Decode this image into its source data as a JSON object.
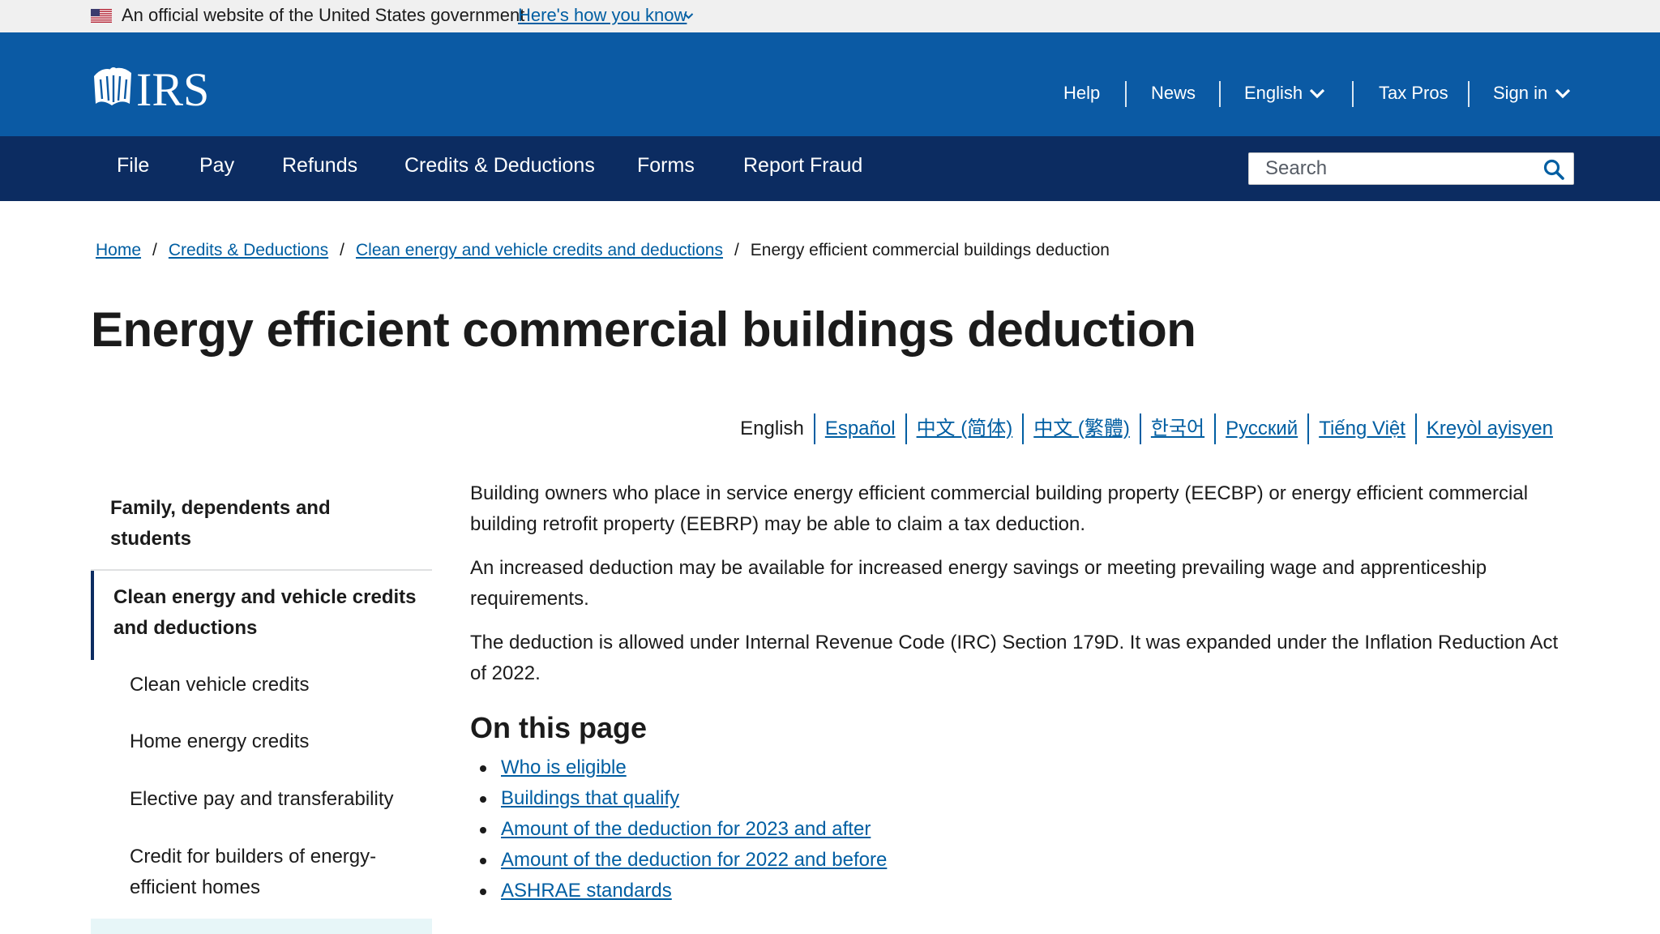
{
  "gov_banner": {
    "text": "An official website of the United States government",
    "link_label": "Here's how you know"
  },
  "header": {
    "logo_text": "IRS",
    "utility_nav": [
      {
        "label": "Help"
      },
      {
        "label": "News"
      },
      {
        "label": "English",
        "has_dropdown": true
      },
      {
        "label": "Tax Pros"
      },
      {
        "label": "Sign in",
        "has_dropdown": true
      }
    ]
  },
  "main_nav": {
    "items": [
      {
        "label": "File"
      },
      {
        "label": "Pay"
      },
      {
        "label": "Refunds"
      },
      {
        "label": "Credits & Deductions"
      },
      {
        "label": "Forms"
      },
      {
        "label": "Report Fraud"
      }
    ],
    "search_placeholder": "Search",
    "search_value": ""
  },
  "breadcrumb": [
    {
      "label": "Home",
      "is_link": true
    },
    {
      "label": "Credits & Deductions",
      "is_link": true
    },
    {
      "label": "Clean energy and vehicle credits and deductions",
      "is_link": true
    },
    {
      "label": "Energy efficient commercial buildings deduction",
      "is_link": false
    }
  ],
  "page_title": "Energy efficient commercial buildings deduction",
  "languages": [
    {
      "label": "English",
      "current": true
    },
    {
      "label": "Español"
    },
    {
      "label": "中文 (简体)"
    },
    {
      "label": "中文 (繁體)"
    },
    {
      "label": "한국어"
    },
    {
      "label": "Русский"
    },
    {
      "label": "Tiếng Việt"
    },
    {
      "label": "Kreyòl ayisyen"
    }
  ],
  "sidebar": {
    "group_label": "Family, dependents and students",
    "active_label": "Clean energy and vehicle credits and deductions",
    "sub_items": [
      {
        "label": "Clean vehicle credits"
      },
      {
        "label": "Home energy credits"
      },
      {
        "label": "Elective pay and transferability"
      },
      {
        "label": "Credit for builders of energy-efficient homes"
      }
    ]
  },
  "content": {
    "paragraphs": [
      "Building owners who place in service energy efficient commercial building property (EECBP) or energy efficient commercial building retrofit property (EEBRP) may be able to claim a tax deduction.",
      "An increased deduction may be available for increased energy savings or meeting prevailing wage and apprenticeship requirements.",
      "The deduction is allowed under Internal Revenue Code (IRC) Section 179D. It was expanded under the Inflation Reduction Act of 2022."
    ],
    "on_this_page_heading": "On this page",
    "toc": [
      {
        "label": "Who is eligible"
      },
      {
        "label": "Buildings that qualify"
      },
      {
        "label": "Amount of the deduction for 2023 and after"
      },
      {
        "label": "Amount of the deduction for 2022 and before"
      },
      {
        "label": "ASHRAE standards"
      }
    ]
  },
  "colors": {
    "header_blue": "#0b5aa4",
    "nav_navy": "#0c2c61",
    "link_blue": "#005ea2",
    "banner_gray": "#f0f0f0",
    "sidebar_next_bg": "#e7f6f8"
  },
  "icons": [
    "us-flag-icon",
    "chevron-down-icon",
    "irs-eagle-logo",
    "search-icon"
  ]
}
